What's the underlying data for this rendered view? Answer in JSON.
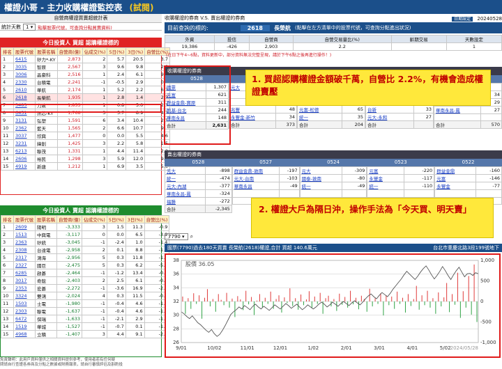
{
  "app": {
    "title": "權證小哥 - 主力收購權證監控表",
    "badge": "(試閱)",
    "stats_label": "統計天數",
    "stats_value": "1",
    "hint_left": "點擊股票代號，可查詢分點買賣資料)",
    "sub_caption_left": "自營商權證買賣超統計表"
  },
  "right_header": {
    "caption": "收購權證的券商 V.S. 賣出權證的券商",
    "date_label": "日期設定",
    "date_value": "20240528",
    "query_label": "目前查詢的標的:",
    "query_code": "2618",
    "query_name": "長榮航",
    "query_hint": "(點擊在左方清單中的股票代號，可查詢分點進出狀況)"
  },
  "summary": {
    "headers": [
      "外資",
      "投信",
      "自營商",
      "自營交易量比(%)",
      "齡期交易",
      "天數設定"
    ],
    "values": [
      "19,386",
      "-426",
      "2,903",
      "2.2",
      "",
      "1"
    ],
    "note": "(在日下午4~6點，資料更新中，部分資料無法完整呈現，請於下午6點之後再進行操作！)"
  },
  "left_top": {
    "header": "今日投資人 買超 認購權證標的",
    "columns": [
      "排名",
      "股票代號",
      "股票名稱",
      "自營商(億)",
      "佔成交(%)",
      "5日(%)",
      "3日(%)",
      "自營比(%)"
    ],
    "rows": [
      [
        "1",
        "6415",
        "矽力*-KY",
        "2,873",
        "2",
        "5.7",
        "20.5",
        "3.7"
      ],
      [
        "2",
        "3035",
        "智原",
        "2,567",
        "3",
        "9.6",
        "9.8",
        "2.8"
      ],
      [
        "3",
        "3006",
        "晶豪科",
        "2,516",
        "1",
        "2.4",
        "6.1",
        "9.6"
      ],
      [
        "4",
        "2330",
        "台積電",
        "2,241",
        "-1",
        "-0.5",
        "2.9",
        "0.2"
      ],
      [
        "5",
        "2610",
        "華航",
        "2,174",
        "1",
        "5.2",
        "2.2",
        "6.7"
      ],
      [
        "6",
        "2618",
        "長榮航",
        "1,935",
        "1",
        "2.8",
        "1.4",
        "2.2"
      ],
      [
        "7",
        "3483",
        "力致",
        "1,853",
        "1",
        "0.8",
        "5.0",
        "2.3"
      ],
      [
        "8",
        "6451",
        "訊芯-KY",
        "1,768",
        "3",
        "5.7",
        "8.9",
        "4.7"
      ],
      [
        "9",
        "3131",
        "弘塑",
        "1,591",
        "6",
        "3.4",
        "10.4",
        "2.1"
      ],
      [
        "10",
        "2362",
        "藍天",
        "1,565",
        "2",
        "6.6",
        "10.7",
        "9.4"
      ],
      [
        "11",
        "3037",
        "欣興",
        "1,477",
        "0",
        "0.0",
        "5.5",
        "4.6"
      ],
      [
        "12",
        "3231",
        "緯創",
        "1,425",
        "3",
        "2.2",
        "5.8",
        "1.5"
      ],
      [
        "13",
        "6213",
        "聯茂",
        "1,331",
        "1",
        "4.4",
        "11.4",
        "2.2"
      ],
      [
        "14",
        "2606",
        "裕民",
        "1,298",
        "3",
        "5.9",
        "12.0",
        "9.7"
      ],
      [
        "15",
        "4919",
        "新唐",
        "1,212",
        "1",
        "6.9",
        "3.5",
        "5.8"
      ]
    ]
  },
  "left_bottom": {
    "header": "今日投資人 賣超 認購權證標的",
    "columns": [
      "排名",
      "股票代號",
      "股票名稱",
      "自營商(億)",
      "佔成交(%)",
      "5日(%)",
      "3日(%)",
      "自營比(%)"
    ],
    "rows": [
      [
        "1",
        "2609",
        "陽明",
        "-3,333",
        "3",
        "1.5",
        "11.3",
        "-0.9"
      ],
      [
        "2",
        "1513",
        "中興電",
        "-3,117",
        "0",
        "0.0",
        "6.5",
        "-3.9"
      ],
      [
        "3",
        "2363",
        "矽統",
        "-3,045",
        "-1",
        "-2.4",
        "1.0",
        "-1.4"
      ],
      [
        "4",
        "2308",
        "台達電",
        "-2,958",
        "2",
        "0.1",
        "8.8",
        "-1.1"
      ],
      [
        "5",
        "2317",
        "鴻海",
        "-2,956",
        "5",
        "0.3",
        "11.8",
        "-1.4"
      ],
      [
        "6",
        "2327",
        "國巨",
        "-2,475",
        "5",
        "0.3",
        "6.2",
        "-5.6"
      ],
      [
        "7",
        "6285",
        "啟碁",
        "-2,464",
        "-1",
        "-1.2",
        "13.4",
        "-0.7"
      ],
      [
        "8",
        "3017",
        "奇鋐",
        "-2,403",
        "2",
        "2.5",
        "6.1",
        "-0.6"
      ],
      [
        "9",
        "2353",
        "宏碁",
        "-2,272",
        "-1",
        "-3.6",
        "16.9",
        "-2.7"
      ],
      [
        "10",
        "3324",
        "雙鴻",
        "-2,024",
        "4",
        "0.3",
        "11.5",
        "-0.1"
      ],
      [
        "11",
        "1503",
        "士電",
        "-1,980",
        "-1",
        "-0.4",
        "4.6",
        "-1.0"
      ],
      [
        "12",
        "2303",
        "聯電",
        "-1,637",
        "-1",
        "-0.4",
        "4.6",
        "-1.0"
      ],
      [
        "13",
        "6472",
        "保瑞",
        "-1,633",
        "-1",
        "-2.1",
        "2.9",
        "-1.9"
      ],
      [
        "14",
        "1519",
        "華城",
        "-1,527",
        "-1",
        "-0.7",
        "0.1",
        "-1.2"
      ],
      [
        "15",
        "4968",
        "立積",
        "-1,407",
        "3",
        "4.4",
        "9.1",
        "-2.5"
      ]
    ]
  },
  "footer": {
    "line1": "免責聲明：此用戶資料僅供之相關資料提供參考，使用者若有任何疑",
    "line2": "問請自行查證各券商及分點之數據或財務報表，請自行審慎評估及斟酌投"
  },
  "buy_brokers": {
    "header": "收購權證的券商",
    "date": "0528",
    "rows": [
      [
        "國票",
        "1,307"
      ],
      [
        "元富",
        "621"
      ],
      [
        "群益金鼎-寶原",
        "311"
      ],
      [
        "凱基-台北",
        "244"
      ],
      [
        "華南永昌",
        "148"
      ]
    ],
    "total_label": "合計",
    "total": "2,631",
    "other_cols": [
      [
        [
          "元大",
          ""
        ],
        [
          "",
          ""
        ],
        [
          "",
          ""
        ],
        [
          "兆豐",
          "48"
        ],
        [
          "永豐金-新竹",
          "34"
        ]
      ],
      [
        [
          "",
          ""
        ],
        [
          "",
          ""
        ],
        [
          "",
          ""
        ],
        [
          "元富-松德",
          "65"
        ],
        [
          "統一",
          "35"
        ]
      ],
      [
        [
          "",
          ""
        ],
        [
          "",
          ""
        ],
        [
          "",
          ""
        ],
        [
          "台新",
          "33"
        ],
        [
          "元大-永和",
          "27"
        ]
      ],
      [
        [
          "",
          ""
        ],
        [
          "中國信託-南",
          "34"
        ],
        [
          "群益金鼎",
          "29"
        ],
        [
          "華南永昌-鳳",
          "27"
        ],
        [
          "",
          ""
        ]
      ]
    ],
    "other_totals": [
      "373",
      "204",
      "",
      "570"
    ]
  },
  "sell_brokers": {
    "header": "賣出權證的券商",
    "dates": [
      "0528",
      "0527",
      "0524",
      "0523",
      "0522"
    ],
    "rows": [
      [
        [
          "元大",
          "-898"
        ],
        [
          "群益金鼎-敦南",
          "-197"
        ],
        [
          "元大",
          "-309"
        ],
        [
          "元富",
          "-220"
        ],
        [
          "群益金鼎",
          "-160"
        ]
      ],
      [
        [
          "統一",
          "-474"
        ],
        [
          "元大-台南",
          "-103"
        ],
        [
          "國泰-敦南",
          "-80"
        ],
        [
          "永豐金",
          "-117"
        ],
        [
          "元富",
          "-146"
        ]
      ],
      [
        [
          "元大-內湖",
          "-377"
        ],
        [
          "華南永昌",
          "-49"
        ],
        [
          "統一",
          "-49"
        ],
        [
          "統一",
          "-110"
        ],
        [
          "永豐金",
          "-77"
        ]
      ],
      [
        [
          "華南永昌-鳳",
          "-324"
        ],
        [
          "",
          ""
        ],
        [
          "",
          ""
        ],
        [
          "",
          ""
        ],
        [
          "",
          ""
        ]
      ],
      [
        [
          "福勝",
          "-272"
        ],
        [
          "",
          ""
        ],
        [
          "",
          ""
        ],
        [
          "",
          ""
        ],
        [
          "",
          ""
        ]
      ]
    ],
    "total_label": "合計",
    "total": "-2,345"
  },
  "callouts": {
    "one": "1.  買超認購權證金額破千萬，自營比 2.2%，有機會造成權證賣壓",
    "two": "2.  權證大戶為隔日沖，操作手法為「今天買、明天賣」"
  },
  "chart_bar": {
    "select_value": "7790",
    "caption": "國票(7790)過去180天買賣 長榮航(2618)權證,合計 買超 140.6萬元",
    "address": "台北市重慶北路3段199號地下"
  },
  "chart_data": {
    "type": "bar",
    "title": "",
    "price_label": "股價 36.05",
    "x_ticks": [
      "9/01",
      "10/02",
      "11/01",
      "12/01",
      "1/02",
      "2/01",
      "3/01",
      "4/01",
      "5/02",
      "2024/05/28"
    ],
    "y_left_ticks": [
      38,
      36,
      34,
      32,
      30,
      28,
      26
    ],
    "y_right_ticks": [
      "1,000",
      "500",
      "0",
      "-500",
      "-1,000"
    ],
    "ylim_left": [
      26,
      38
    ],
    "ylim_right": [
      -1000,
      1000
    ],
    "bars": [
      120,
      -300,
      80,
      -180,
      200,
      -60,
      150,
      -420,
      90,
      300,
      -120,
      60,
      -250,
      180,
      40,
      -90,
      210,
      -150,
      70,
      -380,
      130,
      50,
      -210,
      260,
      -70,
      110,
      -330,
      20,
      180,
      -140,
      90,
      -60,
      240,
      -180,
      60,
      150,
      -270,
      100,
      -40,
      320,
      -110,
      80,
      -200,
      170,
      -90,
      50,
      250,
      -160,
      120,
      -60,
      210,
      -300,
      80,
      140,
      -120,
      60,
      -230,
      190,
      -80,
      110,
      -150,
      260,
      -70,
      90,
      -190,
      140,
      60,
      -250,
      310,
      -120,
      80,
      -60,
      200,
      -340,
      150,
      -90,
      120,
      -180,
      240,
      -60,
      90,
      -270,
      180,
      -110,
      60,
      380,
      -200,
      150,
      -90,
      260,
      -150,
      80,
      -300,
      220,
      -120,
      100,
      450,
      -260,
      180,
      -80,
      700,
      -400,
      250,
      -150,
      620,
      -320,
      900,
      -500
    ],
    "price": [
      30.5,
      30.2,
      29.8,
      29.5,
      29.9,
      29.4,
      28.9,
      28.6,
      28.2,
      27.8,
      27.5,
      27.9,
      27.3,
      26.9,
      27.2,
      27.8,
      28.5,
      29.3,
      30.1,
      30.5,
      30.8,
      31.2,
      30.9,
      31.4,
      31.1,
      30.8,
      31.3,
      31.6,
      31.2,
      30.9,
      31.3,
      31.0,
      30.7,
      31.1,
      31.5,
      31.2,
      30.9,
      31.3,
      31.7,
      31.4,
      31.0,
      31.3,
      31.6,
      31.2,
      30.8,
      31.1,
      31.5,
      31.2,
      30.9,
      31.2,
      31.6,
      31.9,
      31.6,
      31.2,
      31.5,
      31.9,
      31.6,
      31.3,
      31.7,
      32.0,
      31.7,
      31.4,
      31.8,
      32.1,
      31.8,
      31.5,
      31.9,
      32.4,
      32.8,
      33.1,
      32.7,
      32.4,
      32.9,
      33.3,
      33.0,
      32.7,
      33.2,
      33.8,
      34.3,
      34.8,
      35.3,
      35.9,
      36.4,
      36.0,
      35.6,
      35.2,
      35.7,
      36.3,
      36.8,
      37.2,
      36.6,
      35.9,
      35.3,
      35.8,
      36.4,
      37.1,
      36.5,
      35.8,
      35.2,
      35.9,
      36.5,
      37.0,
      36.3,
      35.6,
      36.05,
      36.1,
      35.8,
      36.2,
      36.05
    ]
  }
}
